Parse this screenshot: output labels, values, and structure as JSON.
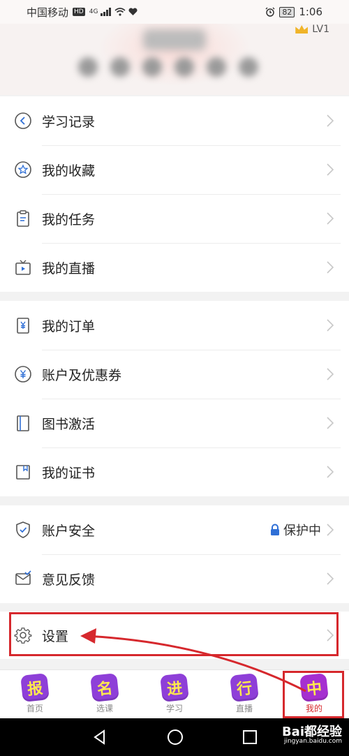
{
  "status_bar": {
    "carrier": "中国移动",
    "hd": "HD",
    "network": "4G",
    "battery": "82",
    "time": "1:06"
  },
  "profile": {
    "level": "LV1"
  },
  "menu_groups": [
    {
      "items": [
        {
          "label": "学习记录",
          "icon": "back-circle-icon"
        },
        {
          "label": "我的收藏",
          "icon": "star-circle-icon"
        },
        {
          "label": "我的任务",
          "icon": "clipboard-icon"
        },
        {
          "label": "我的直播",
          "icon": "tv-play-icon"
        }
      ]
    },
    {
      "items": [
        {
          "label": "我的订单",
          "icon": "order-yen-icon"
        },
        {
          "label": "账户及优惠券",
          "icon": "yen-circle-icon"
        },
        {
          "label": "图书激活",
          "icon": "book-icon"
        },
        {
          "label": "我的证书",
          "icon": "certificate-icon"
        }
      ]
    },
    {
      "items": [
        {
          "label": "账户安全",
          "icon": "shield-check-icon",
          "value": "保护中",
          "value_icon": "lock-icon"
        },
        {
          "label": "意见反馈",
          "icon": "feedback-mail-icon"
        }
      ]
    },
    {
      "items": [
        {
          "label": "设置",
          "icon": "gear-icon"
        }
      ]
    }
  ],
  "tabs": [
    {
      "label": "首页",
      "glyph": "报",
      "color": "#8e3fd8",
      "active": false
    },
    {
      "label": "选课",
      "glyph": "名",
      "color": "#8e3fd8",
      "active": false
    },
    {
      "label": "学习",
      "glyph": "进",
      "color": "#8e3fd8",
      "active": false
    },
    {
      "label": "直播",
      "glyph": "行",
      "color": "#8e3fd8",
      "active": false
    },
    {
      "label": "我的",
      "glyph": "中",
      "color": "#a52fd0",
      "active": true
    }
  ],
  "watermark": {
    "brand": "Bai都经验",
    "url": "jingyan.baidu.com"
  },
  "colors": {
    "highlight": "#d6282d",
    "accent_blue": "#2f6fd6"
  }
}
